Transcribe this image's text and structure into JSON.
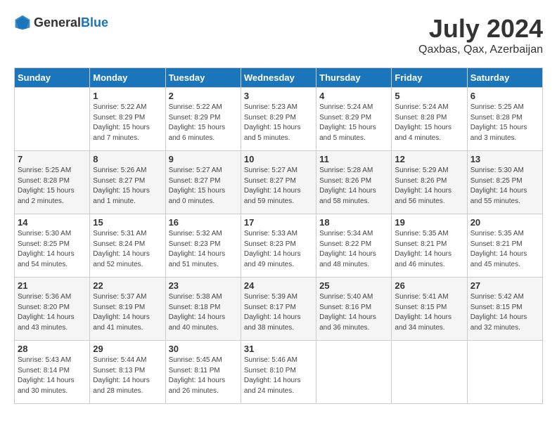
{
  "header": {
    "logo_general": "General",
    "logo_blue": "Blue",
    "month": "July 2024",
    "location": "Qaxbas, Qax, Azerbaijan"
  },
  "weekdays": [
    "Sunday",
    "Monday",
    "Tuesday",
    "Wednesday",
    "Thursday",
    "Friday",
    "Saturday"
  ],
  "weeks": [
    [
      {
        "day": "",
        "info": ""
      },
      {
        "day": "1",
        "info": "Sunrise: 5:22 AM\nSunset: 8:29 PM\nDaylight: 15 hours\nand 7 minutes."
      },
      {
        "day": "2",
        "info": "Sunrise: 5:22 AM\nSunset: 8:29 PM\nDaylight: 15 hours\nand 6 minutes."
      },
      {
        "day": "3",
        "info": "Sunrise: 5:23 AM\nSunset: 8:29 PM\nDaylight: 15 hours\nand 5 minutes."
      },
      {
        "day": "4",
        "info": "Sunrise: 5:24 AM\nSunset: 8:29 PM\nDaylight: 15 hours\nand 5 minutes."
      },
      {
        "day": "5",
        "info": "Sunrise: 5:24 AM\nSunset: 8:28 PM\nDaylight: 15 hours\nand 4 minutes."
      },
      {
        "day": "6",
        "info": "Sunrise: 5:25 AM\nSunset: 8:28 PM\nDaylight: 15 hours\nand 3 minutes."
      }
    ],
    [
      {
        "day": "7",
        "info": "Sunrise: 5:25 AM\nSunset: 8:28 PM\nDaylight: 15 hours\nand 2 minutes."
      },
      {
        "day": "8",
        "info": "Sunrise: 5:26 AM\nSunset: 8:27 PM\nDaylight: 15 hours\nand 1 minute."
      },
      {
        "day": "9",
        "info": "Sunrise: 5:27 AM\nSunset: 8:27 PM\nDaylight: 15 hours\nand 0 minutes."
      },
      {
        "day": "10",
        "info": "Sunrise: 5:27 AM\nSunset: 8:27 PM\nDaylight: 14 hours\nand 59 minutes."
      },
      {
        "day": "11",
        "info": "Sunrise: 5:28 AM\nSunset: 8:26 PM\nDaylight: 14 hours\nand 58 minutes."
      },
      {
        "day": "12",
        "info": "Sunrise: 5:29 AM\nSunset: 8:26 PM\nDaylight: 14 hours\nand 56 minutes."
      },
      {
        "day": "13",
        "info": "Sunrise: 5:30 AM\nSunset: 8:25 PM\nDaylight: 14 hours\nand 55 minutes."
      }
    ],
    [
      {
        "day": "14",
        "info": "Sunrise: 5:30 AM\nSunset: 8:25 PM\nDaylight: 14 hours\nand 54 minutes."
      },
      {
        "day": "15",
        "info": "Sunrise: 5:31 AM\nSunset: 8:24 PM\nDaylight: 14 hours\nand 52 minutes."
      },
      {
        "day": "16",
        "info": "Sunrise: 5:32 AM\nSunset: 8:23 PM\nDaylight: 14 hours\nand 51 minutes."
      },
      {
        "day": "17",
        "info": "Sunrise: 5:33 AM\nSunset: 8:23 PM\nDaylight: 14 hours\nand 49 minutes."
      },
      {
        "day": "18",
        "info": "Sunrise: 5:34 AM\nSunset: 8:22 PM\nDaylight: 14 hours\nand 48 minutes."
      },
      {
        "day": "19",
        "info": "Sunrise: 5:35 AM\nSunset: 8:21 PM\nDaylight: 14 hours\nand 46 minutes."
      },
      {
        "day": "20",
        "info": "Sunrise: 5:35 AM\nSunset: 8:21 PM\nDaylight: 14 hours\nand 45 minutes."
      }
    ],
    [
      {
        "day": "21",
        "info": "Sunrise: 5:36 AM\nSunset: 8:20 PM\nDaylight: 14 hours\nand 43 minutes."
      },
      {
        "day": "22",
        "info": "Sunrise: 5:37 AM\nSunset: 8:19 PM\nDaylight: 14 hours\nand 41 minutes."
      },
      {
        "day": "23",
        "info": "Sunrise: 5:38 AM\nSunset: 8:18 PM\nDaylight: 14 hours\nand 40 minutes."
      },
      {
        "day": "24",
        "info": "Sunrise: 5:39 AM\nSunset: 8:17 PM\nDaylight: 14 hours\nand 38 minutes."
      },
      {
        "day": "25",
        "info": "Sunrise: 5:40 AM\nSunset: 8:16 PM\nDaylight: 14 hours\nand 36 minutes."
      },
      {
        "day": "26",
        "info": "Sunrise: 5:41 AM\nSunset: 8:15 PM\nDaylight: 14 hours\nand 34 minutes."
      },
      {
        "day": "27",
        "info": "Sunrise: 5:42 AM\nSunset: 8:15 PM\nDaylight: 14 hours\nand 32 minutes."
      }
    ],
    [
      {
        "day": "28",
        "info": "Sunrise: 5:43 AM\nSunset: 8:14 PM\nDaylight: 14 hours\nand 30 minutes."
      },
      {
        "day": "29",
        "info": "Sunrise: 5:44 AM\nSunset: 8:13 PM\nDaylight: 14 hours\nand 28 minutes."
      },
      {
        "day": "30",
        "info": "Sunrise: 5:45 AM\nSunset: 8:11 PM\nDaylight: 14 hours\nand 26 minutes."
      },
      {
        "day": "31",
        "info": "Sunrise: 5:46 AM\nSunset: 8:10 PM\nDaylight: 14 hours\nand 24 minutes."
      },
      {
        "day": "",
        "info": ""
      },
      {
        "day": "",
        "info": ""
      },
      {
        "day": "",
        "info": ""
      }
    ]
  ]
}
